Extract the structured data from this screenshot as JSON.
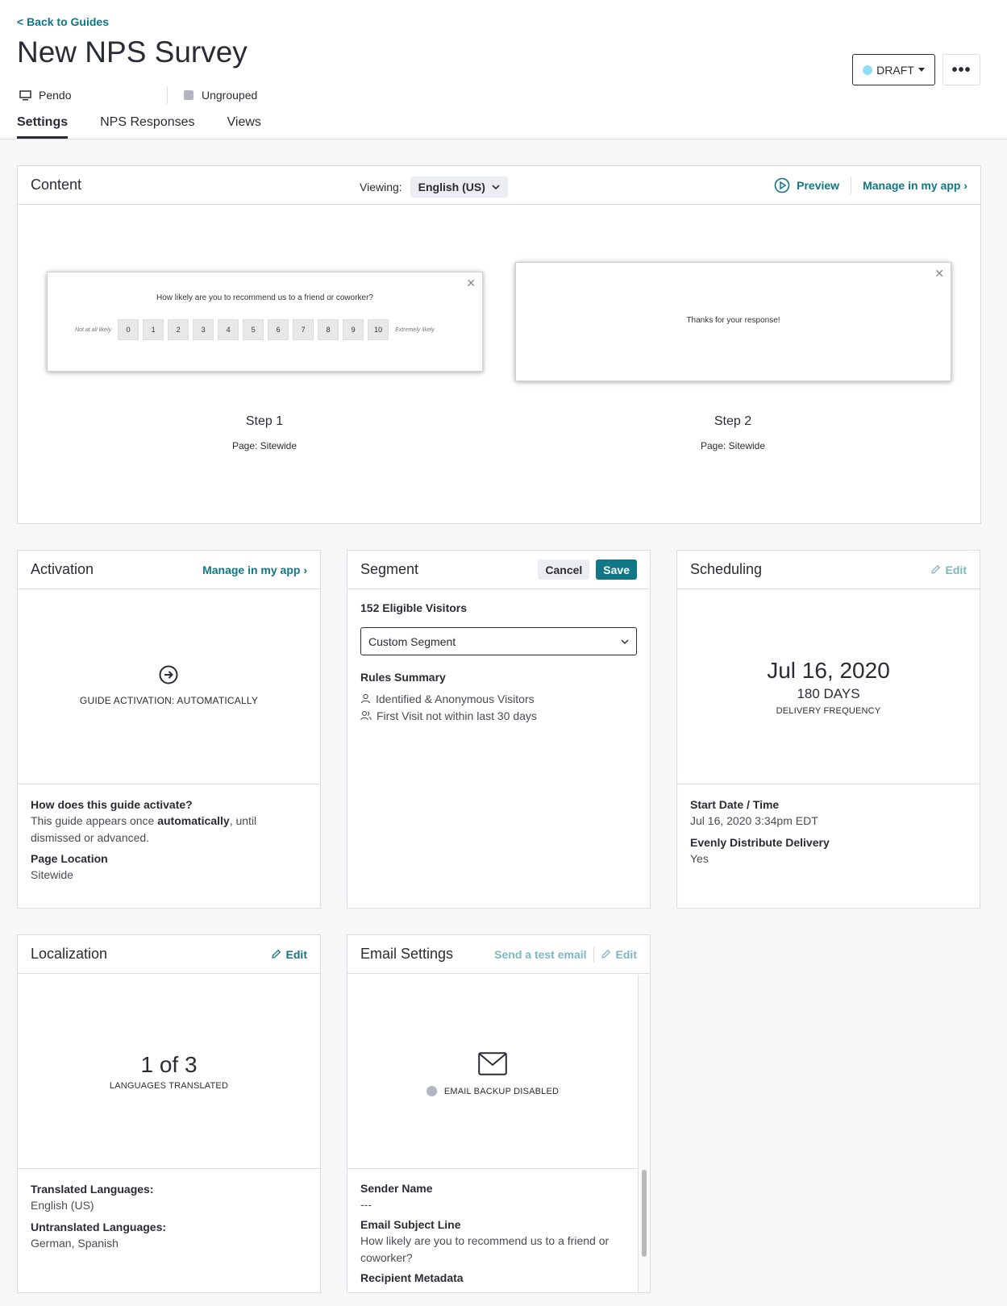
{
  "header": {
    "back_link": "< Back to Guides",
    "title": "New NPS Survey",
    "app_name": "Pendo",
    "group_name": "Ungrouped",
    "status_label": "DRAFT",
    "more_label": "•••"
  },
  "tabs": [
    {
      "label": "Settings",
      "active": true
    },
    {
      "label": "NPS Responses",
      "active": false
    },
    {
      "label": "Views",
      "active": false
    }
  ],
  "content": {
    "title": "Content",
    "viewing_label": "Viewing:",
    "language": "English (US)",
    "preview_label": "Preview",
    "manage_label": "Manage in my app ›",
    "steps": [
      {
        "name": "Step 1",
        "page": "Page: Sitewide",
        "question": "How likely are you to recommend us to a friend or coworker?",
        "low_label": "Not at all likely",
        "high_label": "Extremely likely",
        "scale": [
          "0",
          "1",
          "2",
          "3",
          "4",
          "5",
          "6",
          "7",
          "8",
          "9",
          "10"
        ]
      },
      {
        "name": "Step 2",
        "page": "Page: Sitewide",
        "message": "Thanks for your response!"
      }
    ]
  },
  "activation": {
    "title": "Activation",
    "manage_label": "Manage in my app ›",
    "status": "GUIDE ACTIVATION: AUTOMATICALLY",
    "how_label": "How does this guide activate?",
    "how_prefix": "This guide appears once ",
    "how_bold": "automatically",
    "how_suffix": ", until dismissed or advanced.",
    "page_location_label": "Page Location",
    "page_location_value": "Sitewide"
  },
  "segment": {
    "title": "Segment",
    "cancel_label": "Cancel",
    "save_label": "Save",
    "eligible": "152 Eligible Visitors",
    "selected_segment": "Custom Segment",
    "rules_label": "Rules Summary",
    "rules": [
      "Identified & Anonymous Visitors",
      "First Visit not within last 30 days"
    ]
  },
  "scheduling": {
    "title": "Scheduling",
    "edit_label": "Edit",
    "date": "Jul 16, 2020",
    "days": "180 DAYS",
    "frequency_label": "DELIVERY FREQUENCY",
    "start_label": "Start Date / Time",
    "start_value": "Jul 16, 2020 3:34pm EDT",
    "distribute_label": "Evenly Distribute Delivery",
    "distribute_value": "Yes"
  },
  "localization": {
    "title": "Localization",
    "edit_label": "Edit",
    "count": "1 of 3",
    "count_label": "LANGUAGES TRANSLATED",
    "translated_label": "Translated Languages:",
    "translated_value": "English (US)",
    "untranslated_label": "Untranslated Languages:",
    "untranslated_value": "German, Spanish"
  },
  "email": {
    "title": "Email Settings",
    "test_label": "Send a test email",
    "edit_label": "Edit",
    "status": "EMAIL BACKUP DISABLED",
    "sender_label": "Sender Name",
    "sender_value": "---",
    "subject_label": "Email Subject Line",
    "subject_value": "How likely are you to recommend us to a friend or coworker?",
    "recipient_label": "Recipient Metadata"
  },
  "colors": {
    "accent": "#117685",
    "draft_dot": "#8edcf5",
    "text": "#2a2c35",
    "border": "#dadce5"
  }
}
